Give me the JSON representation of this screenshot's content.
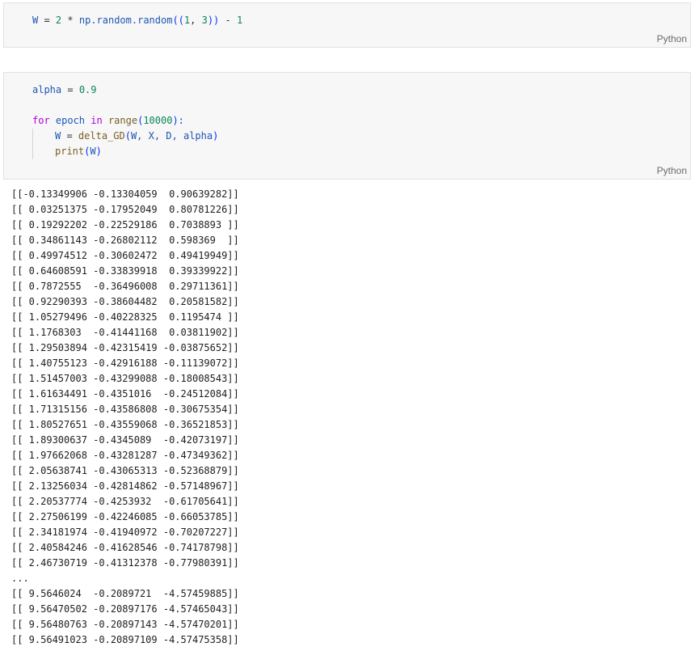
{
  "cells": [
    {
      "language": "Python",
      "code": {
        "line1": {
          "var": "W",
          "op1": " = ",
          "num1": "2",
          "op2": " * ",
          "obj": "np.random.random",
          "paren_open": "((",
          "num2": "1",
          "comma": ", ",
          "num3": "3",
          "paren_close": "))",
          "op3": " - ",
          "num4": "1"
        }
      }
    },
    {
      "language": "Python",
      "code": {
        "line1": {
          "var": "alpha",
          "op": " = ",
          "num": "0.9"
        },
        "line3": {
          "kw_for": "for",
          "var": " epoch ",
          "kw_in": "in",
          "fn": " range",
          "paren_open": "(",
          "num": "10000",
          "paren_close": "):"
        },
        "line4": {
          "var": "W",
          "op": " = ",
          "fn": "delta_GD",
          "paren_open": "(",
          "args": "W, X, D, alpha",
          "paren_close": ")"
        },
        "line5": {
          "fn": "print",
          "paren_open": "(",
          "arg": "W",
          "paren_close": ")"
        }
      }
    }
  ],
  "output_lines": [
    "[[-0.13349906 -0.13304059  0.90639282]]",
    "[[ 0.03251375 -0.17952049  0.80781226]]",
    "[[ 0.19292202 -0.22529186  0.7038893 ]]",
    "[[ 0.34861143 -0.26802112  0.598369  ]]",
    "[[ 0.49974512 -0.30602472  0.49419949]]",
    "[[ 0.64608591 -0.33839918  0.39339922]]",
    "[[ 0.7872555  -0.36496008  0.29711361]]",
    "[[ 0.92290393 -0.38604482  0.20581582]]",
    "[[ 1.05279496 -0.40228325  0.1195474 ]]",
    "[[ 1.1768303  -0.41441168  0.03811902]]",
    "[[ 1.29503894 -0.42315419 -0.03875652]]",
    "[[ 1.40755123 -0.42916188 -0.11139072]]",
    "[[ 1.51457003 -0.43299088 -0.18008543]]",
    "[[ 1.61634491 -0.4351016  -0.24512084]]",
    "[[ 1.71315156 -0.43586808 -0.30675354]]",
    "[[ 1.80527651 -0.43559068 -0.36521853]]",
    "[[ 1.89300637 -0.4345089  -0.42073197]]",
    "[[ 1.97662068 -0.43281287 -0.47349362]]",
    "[[ 2.05638741 -0.43065313 -0.52368879]]",
    "[[ 2.13256034 -0.42814862 -0.57148967]]",
    "[[ 2.20537774 -0.4253932  -0.61705641]]",
    "[[ 2.27506199 -0.42246085 -0.66053785]]",
    "[[ 2.34181974 -0.41940972 -0.70207227]]",
    "[[ 2.40584246 -0.41628546 -0.74178798]]",
    "[[ 2.46730719 -0.41312378 -0.77980391]]",
    "...",
    "[[ 9.5646024  -0.2089721  -4.57459885]]",
    "[[ 9.56470502 -0.20897176 -4.57465043]]",
    "[[ 9.56480763 -0.20897143 -4.57470201]]",
    "[[ 9.56491023 -0.20897109 -4.57475358]]"
  ]
}
